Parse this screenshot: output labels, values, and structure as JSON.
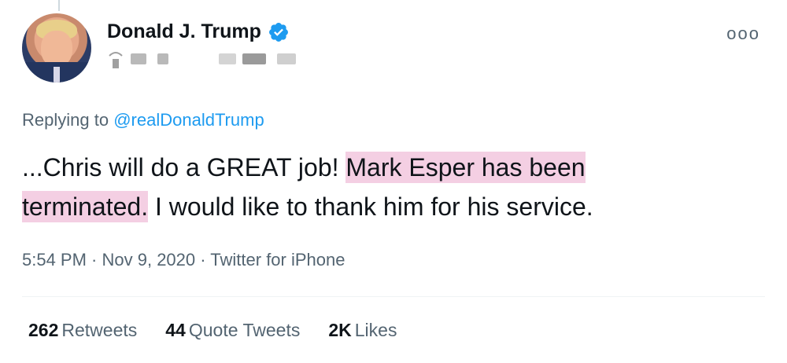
{
  "author": {
    "display_name": "Donald J. Trump",
    "verified": true,
    "avatar_icon": "profile-photo"
  },
  "more_icon": "ooo",
  "reply": {
    "prefix": "Replying to",
    "mention": "@realDonaldTrump"
  },
  "tweet": {
    "text_part1": "...Chris will do a GREAT job! ",
    "highlight1": "Mark Esper has been",
    "highlight2": "terminated.",
    "text_part2": " I would like to thank him for his service."
  },
  "meta": {
    "time": "5:54 PM",
    "date": "Nov 9, 2020",
    "source": "Twitter for iPhone",
    "separator": " · "
  },
  "stats": {
    "retweets": {
      "count": "262",
      "label": "Retweets"
    },
    "quote_tweets": {
      "count": "44",
      "label": "Quote Tweets"
    },
    "likes": {
      "count": "2K",
      "label": "Likes"
    }
  },
  "colors": {
    "accent": "#1d9bf0",
    "highlight": "#f4cfe3",
    "secondary_text": "#536471"
  }
}
